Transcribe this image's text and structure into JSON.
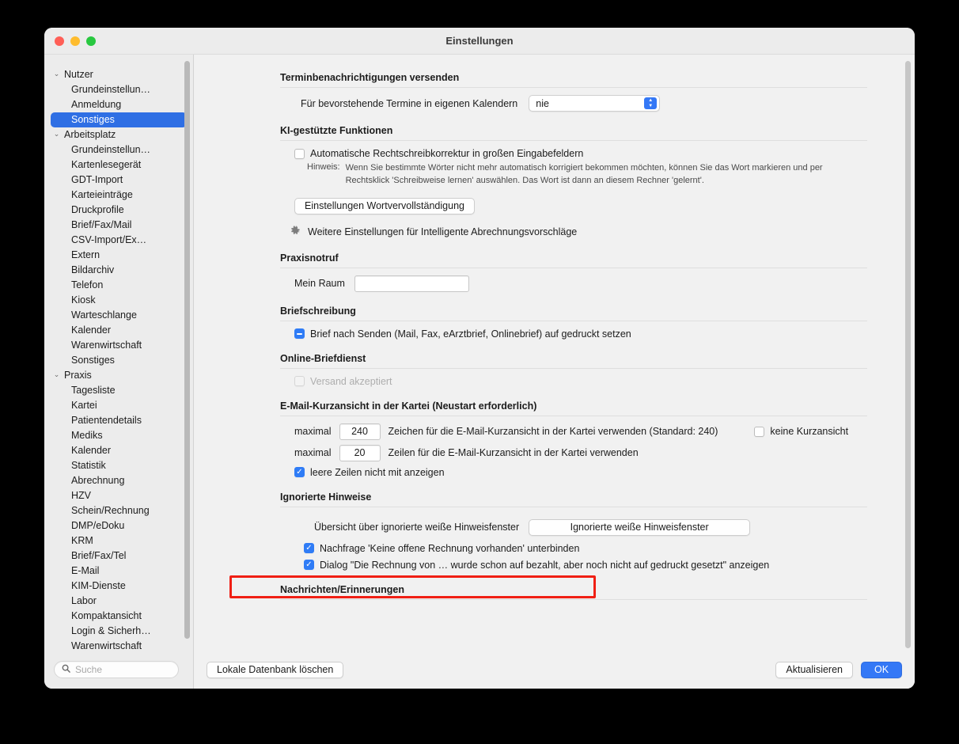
{
  "window": {
    "title": "Einstellungen",
    "accent": "#3478f6",
    "selection_blue": "#2f6fe4",
    "highlight_red": "#f01f14"
  },
  "sidebar": {
    "items": [
      {
        "label": "Nutzer",
        "type": "group",
        "chevron": "chevron-down-icon",
        "selected": false
      },
      {
        "label": "Grundeinstellun…",
        "type": "child",
        "selected": false
      },
      {
        "label": "Anmeldung",
        "type": "child",
        "selected": false
      },
      {
        "label": "Sonstiges",
        "type": "child",
        "selected": true
      },
      {
        "label": "Arbeitsplatz",
        "type": "group",
        "chevron": "chevron-down-icon",
        "selected": false
      },
      {
        "label": "Grundeinstellun…",
        "type": "child",
        "selected": false
      },
      {
        "label": "Kartenlesegerät",
        "type": "child",
        "selected": false
      },
      {
        "label": "GDT-Import",
        "type": "child",
        "selected": false
      },
      {
        "label": "Karteieinträge",
        "type": "child",
        "selected": false
      },
      {
        "label": "Druckprofile",
        "type": "child",
        "selected": false
      },
      {
        "label": "Brief/Fax/Mail",
        "type": "child",
        "selected": false
      },
      {
        "label": "CSV-Import/Ex…",
        "type": "child",
        "selected": false
      },
      {
        "label": "Extern",
        "type": "child",
        "selected": false
      },
      {
        "label": "Bildarchiv",
        "type": "child",
        "selected": false
      },
      {
        "label": "Telefon",
        "type": "child",
        "selected": false
      },
      {
        "label": "Kiosk",
        "type": "child",
        "selected": false
      },
      {
        "label": "Warteschlange",
        "type": "child",
        "selected": false
      },
      {
        "label": "Kalender",
        "type": "child",
        "selected": false
      },
      {
        "label": "Warenwirtschaft",
        "type": "child",
        "selected": false
      },
      {
        "label": "Sonstiges",
        "type": "child",
        "selected": false
      },
      {
        "label": "Praxis",
        "type": "group",
        "chevron": "chevron-down-icon",
        "selected": false
      },
      {
        "label": "Tagesliste",
        "type": "child",
        "selected": false
      },
      {
        "label": "Kartei",
        "type": "child",
        "selected": false
      },
      {
        "label": "Patientendetails",
        "type": "child",
        "selected": false
      },
      {
        "label": "Mediks",
        "type": "child",
        "selected": false
      },
      {
        "label": "Kalender",
        "type": "child",
        "selected": false
      },
      {
        "label": "Statistik",
        "type": "child",
        "selected": false
      },
      {
        "label": "Abrechnung",
        "type": "child",
        "selected": false
      },
      {
        "label": "HZV",
        "type": "child",
        "selected": false
      },
      {
        "label": "Schein/Rechnung",
        "type": "child",
        "selected": false
      },
      {
        "label": "DMP/eDoku",
        "type": "child",
        "selected": false
      },
      {
        "label": "KRM",
        "type": "child",
        "selected": false
      },
      {
        "label": "Brief/Fax/Tel",
        "type": "child",
        "selected": false
      },
      {
        "label": "E-Mail",
        "type": "child",
        "selected": false
      },
      {
        "label": "KIM-Dienste",
        "type": "child",
        "selected": false
      },
      {
        "label": "Labor",
        "type": "child",
        "selected": false
      },
      {
        "label": "Kompaktansicht",
        "type": "child",
        "selected": false
      },
      {
        "label": "Login & Sicherh…",
        "type": "child",
        "selected": false
      },
      {
        "label": "Warenwirtschaft",
        "type": "child",
        "selected": false
      }
    ],
    "search": {
      "placeholder": "Suche",
      "value": "",
      "icon": "search-icon"
    }
  },
  "main": {
    "termin": {
      "section_title": "Terminbenachrichtigungen versenden",
      "row_label": "Für bevorstehende Termine in eigenen Kalendern",
      "popup_value": "nie"
    },
    "ki": {
      "section_title": "KI-gestützte Funktionen",
      "autocorrect_label": "Automatische Rechtschreibkorrektur in großen Eingabefeldern",
      "autocorrect_checked": false,
      "hint_label": "Hinweis:",
      "hint_text": "Wenn Sie bestimmte Wörter nicht mehr automatisch korrigiert bekommen möchten, können Sie das Wort markieren und per Rechtsklick 'Schreibweise lernen' auswählen. Das Wort ist dann an diesem Rechner 'gelernt'.",
      "wordcompletion_button": "Einstellungen Wortvervollständigung",
      "billing_link": "Weitere Einstellungen für Intelligente Abrechnungsvorschläge",
      "billing_icon": "gear-icon"
    },
    "praxisnotruf": {
      "section_title": "Praxisnotruf",
      "room_label": "Mein Raum",
      "room_value": ""
    },
    "briefschreibung": {
      "section_title": "Briefschreibung",
      "checkbox_label": "Brief nach Senden (Mail, Fax, eArztbrief, Onlinebrief) auf gedruckt setzen",
      "checkbox_state": "mixed"
    },
    "online_briefdienst": {
      "section_title": "Online-Briefdienst",
      "checkbox_label": "Versand akzeptiert",
      "checkbox_checked": false,
      "disabled": true
    },
    "email_kurzansicht": {
      "section_title": "E-Mail-Kurzansicht in der Kartei (Neustart erforderlich)",
      "row1_prefix": "maximal",
      "row1_value": "240",
      "row1_suffix": "Zeichen für die E-Mail-Kurzansicht in der Kartei verwenden (Standard: 240)",
      "row1_right_checkbox_label": "keine Kurzansicht",
      "row1_right_checkbox_checked": false,
      "row2_prefix": "maximal",
      "row2_value": "20",
      "row2_suffix": "Zeilen für die E-Mail-Kurzansicht in der Kartei verwenden",
      "row3_checkbox_label": "leere Zeilen nicht mit anzeigen",
      "row3_checkbox_checked": true
    },
    "ignorierte_hinweise": {
      "section_title": "Ignorierte Hinweise",
      "overview_label": "Übersicht über ignorierte weiße Hinweisfenster",
      "overview_button": "Ignorierte weiße Hinweisfenster",
      "cb1_label": "Nachfrage 'Keine offene Rechnung vorhanden' unterbinden",
      "cb1_checked": true,
      "cb1_highlighted": true,
      "cb2_label": "Dialog \"Die Rechnung von … wurde schon auf bezahlt, aber noch nicht auf gedruckt gesetzt\" anzeigen",
      "cb2_checked": true
    },
    "nachrichten": {
      "section_title": "Nachrichten/Erinnerungen"
    }
  },
  "footer": {
    "delete_local_db": "Lokale Datenbank löschen",
    "refresh": "Aktualisieren",
    "ok": "OK"
  }
}
